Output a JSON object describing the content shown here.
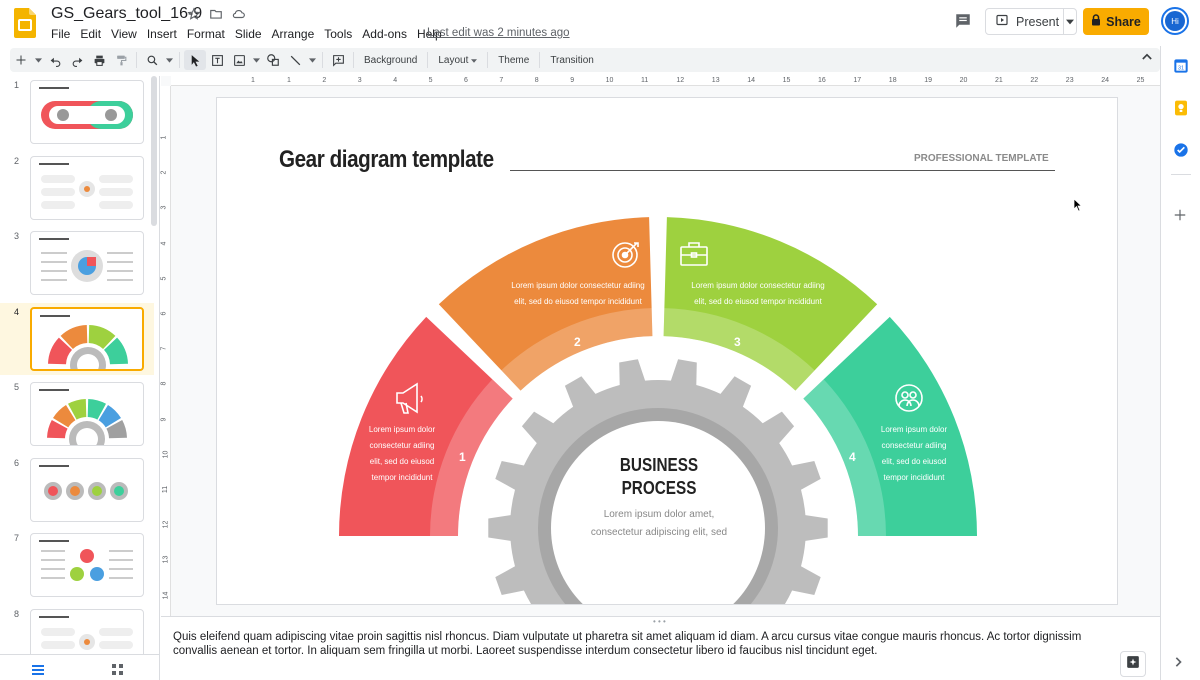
{
  "header": {
    "title": "GS_Gears_tool_16-9",
    "menu": [
      "File",
      "Edit",
      "View",
      "Insert",
      "Format",
      "Slide",
      "Arrange",
      "Tools",
      "Add-ons",
      "Help"
    ],
    "last_edit": "Last edit was 2 minutes ago",
    "present_label": "Present",
    "share_label": "Share",
    "avatar_initials": "Hi"
  },
  "toolbar": {
    "background": "Background",
    "layout": "Layout",
    "theme": "Theme",
    "transition": "Transition"
  },
  "ruler": {
    "horizontal": [
      "1",
      "1",
      "2",
      "3",
      "4",
      "5",
      "6",
      "7",
      "8",
      "9",
      "10",
      "11",
      "12",
      "13",
      "14",
      "15",
      "16",
      "17",
      "18",
      "19",
      "20",
      "21",
      "22",
      "23",
      "24",
      "25"
    ],
    "vertical": [
      "1",
      "2",
      "3",
      "4",
      "5",
      "6",
      "7",
      "8",
      "9",
      "10",
      "11",
      "12",
      "13",
      "14"
    ]
  },
  "filmstrip": {
    "slides": [
      {
        "num": "1"
      },
      {
        "num": "2"
      },
      {
        "num": "3"
      },
      {
        "num": "4"
      },
      {
        "num": "5"
      },
      {
        "num": "6"
      },
      {
        "num": "7"
      },
      {
        "num": "8"
      }
    ],
    "active": 4
  },
  "slide": {
    "title": "Gear diagram template",
    "tag": "PROFESSIONAL TEMPLATE",
    "segments": [
      {
        "num": "1",
        "text": [
          "Lorem ipsum dolor",
          "consectetur adiing",
          "elit, sed do eiusod",
          "tempor incididunt"
        ],
        "color": "#f0555a"
      },
      {
        "num": "2",
        "text": [
          "Lorem ipsum dolor consectetur adiing",
          "elit, sed do eiusod tempor incididunt"
        ],
        "color": "#ec8a3d"
      },
      {
        "num": "3",
        "text": [
          "Lorem ipsum dolor consectetur adiing",
          "elit, sed do eiusod tempor incididunt"
        ],
        "color": "#9ed13f"
      },
      {
        "num": "4",
        "text": [
          "Lorem ipsum dolor",
          "consectetur adiing",
          "elit, sed do eiusod",
          "tempor incididunt"
        ],
        "color": "#3dcf9b"
      }
    ],
    "center_title": [
      "BUSINESS",
      "PROCESS"
    ],
    "center_body": [
      "Lorem ipsum dolor amet,",
      "consectetur adipiscing elit, sed"
    ]
  },
  "notes": {
    "text": "Quis eleifend quam adipiscing vitae proin sagittis nisl rhoncus. Diam vulputate ut pharetra sit amet aliquam id diam. A arcu cursus vitae congue mauris rhoncus. Ac tortor dignissim convallis aenean et tortor. In aliquam sem fringilla ut morbi. Laoreet suspendisse interdum consectetur libero id faucibus nisl tincidunt eget."
  }
}
